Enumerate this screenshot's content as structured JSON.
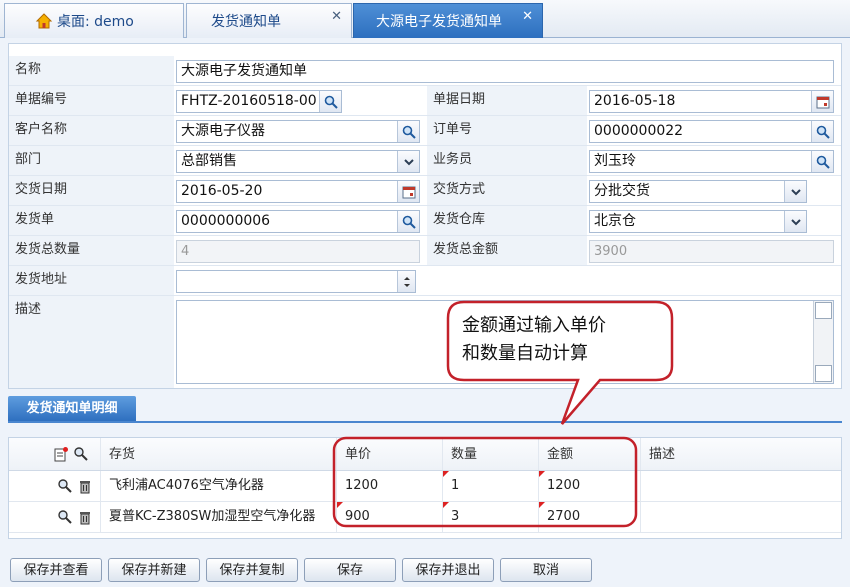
{
  "tabs": [
    {
      "label": "桌面: demo",
      "icon": "home-icon"
    },
    {
      "label": "发货通知单",
      "closable": true
    },
    {
      "label": "大源电子发货通知单",
      "closable": true,
      "active": true
    }
  ],
  "form": {
    "name": {
      "label": "名称",
      "value": "大源电子发货通知单"
    },
    "doc_no": {
      "label": "单据编号",
      "value": "FHTZ-20160518-00"
    },
    "doc_date": {
      "label": "单据日期",
      "value": "2016-05-18"
    },
    "customer": {
      "label": "客户名称",
      "value": "大源电子仪器"
    },
    "order_no": {
      "label": "订单号",
      "value": "0000000022"
    },
    "dept": {
      "label": "部门",
      "value": "总部销售"
    },
    "salesman": {
      "label": "业务员",
      "value": "刘玉玲"
    },
    "delivery_date": {
      "label": "交货日期",
      "value": "2016-05-20"
    },
    "delivery_method": {
      "label": "交货方式",
      "value": "分批交货"
    },
    "ship_no": {
      "label": "发货单",
      "value": "0000000006"
    },
    "warehouse": {
      "label": "发货仓库",
      "value": "北京仓"
    },
    "total_qty": {
      "label": "发货总数量",
      "value": "4"
    },
    "total_amount": {
      "label": "发货总金额",
      "value": "3900"
    },
    "address": {
      "label": "发货地址",
      "value": ""
    },
    "description": {
      "label": "描述",
      "value": ""
    }
  },
  "detail": {
    "tab_label": "发货通知单明细",
    "columns": [
      "存货",
      "单价",
      "数量",
      "金额",
      "描述"
    ],
    "rows": [
      {
        "item": "飞利浦AC4076空气净化器",
        "price": "1200",
        "qty": "1",
        "amount": "1200",
        "desc": ""
      },
      {
        "item": "夏普KC-Z380SW加湿型空气净化器",
        "price": "900",
        "qty": "3",
        "amount": "2700",
        "desc": ""
      }
    ]
  },
  "callout": {
    "line1": "金额通过输入单价",
    "line2": "和数量自动计算",
    "color": "#c3212a"
  },
  "footer": {
    "save_view": "保存并查看",
    "save_new": "保存并新建",
    "save_copy": "保存并复制",
    "save": "保存",
    "save_exit": "保存并退出",
    "cancel": "取消"
  },
  "colors": {
    "accent": "#2d6fbf",
    "annotation": "#c3212a"
  }
}
